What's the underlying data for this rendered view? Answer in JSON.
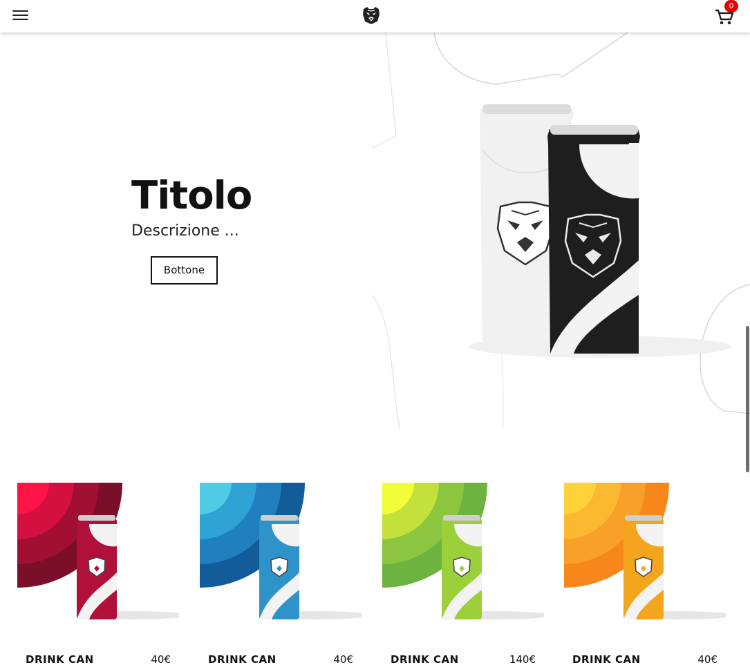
{
  "header": {
    "menu_icon": "hamburger-menu-icon",
    "logo_icon": "tiger-head-logo-icon",
    "cart_icon": "shopping-cart-icon",
    "cart_count": "0"
  },
  "hero": {
    "title": "Titolo",
    "description": "Descrizione ...",
    "button_label": "Bottone"
  },
  "products": [
    {
      "name": "DRINK CAN",
      "price": "40€",
      "color": "#b0103a"
    },
    {
      "name": "DRINK CAN",
      "price": "40€",
      "color": "#1f7fbf"
    },
    {
      "name": "DRINK CAN",
      "price": "140€",
      "color": "#8cc63f"
    },
    {
      "name": "DRINK CAN",
      "price": "40€",
      "color": "#f7a21b"
    }
  ]
}
